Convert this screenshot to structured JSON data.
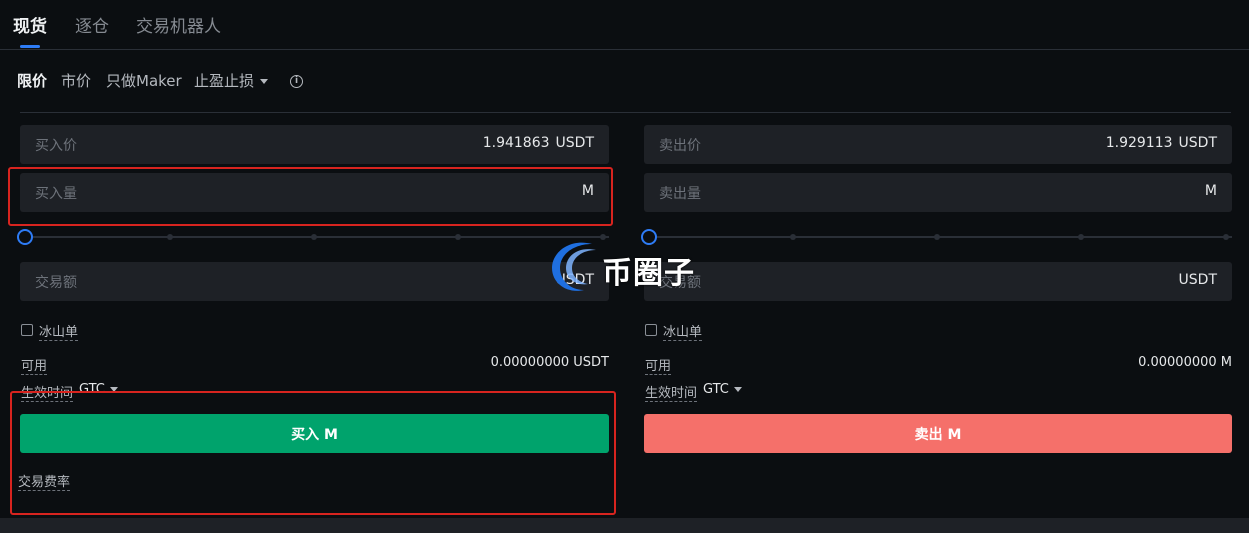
{
  "tabs": [
    {
      "label": "现货",
      "active": true
    },
    {
      "label": "逐仓",
      "active": false
    },
    {
      "label": "交易机器人",
      "active": false
    }
  ],
  "order_types": {
    "limit": "限价",
    "market": "市价",
    "maker_only": "只做Maker",
    "tp_sl": "止盈止损",
    "info_glyph": "i"
  },
  "buy": {
    "price_label": "买入价",
    "price_value": "1.941863",
    "price_unit": "USDT",
    "amount_label": "买入量",
    "amount_unit": "M",
    "slider_percent": 0,
    "total_label": "交易额",
    "total_unit": "USDT",
    "iceberg_label": "冰山单",
    "available_label": "可用",
    "available_value": "0.00000000 USDT",
    "tif_label": "生效时间",
    "tif_value": "GTC",
    "button_label": "买入 M"
  },
  "sell": {
    "price_label": "卖出价",
    "price_value": "1.929113",
    "price_unit": "USDT",
    "amount_label": "卖出量",
    "amount_unit": "M",
    "slider_percent": 0,
    "total_label": "交易额",
    "total_unit": "USDT",
    "iceberg_label": "冰山单",
    "available_label": "可用",
    "available_value": "0.00000000 M",
    "tif_label": "生效时间",
    "tif_value": "GTC",
    "button_label": "卖出 M"
  },
  "fee_label": "交易费率",
  "watermark_text": "币圈子",
  "colors": {
    "background": "#0b0e11",
    "input_bg": "#1e2126",
    "accent_blue": "#2e7cf6",
    "buy_green": "#00a36c",
    "sell_red": "#f5706a",
    "highlight_red": "#d8241f"
  }
}
